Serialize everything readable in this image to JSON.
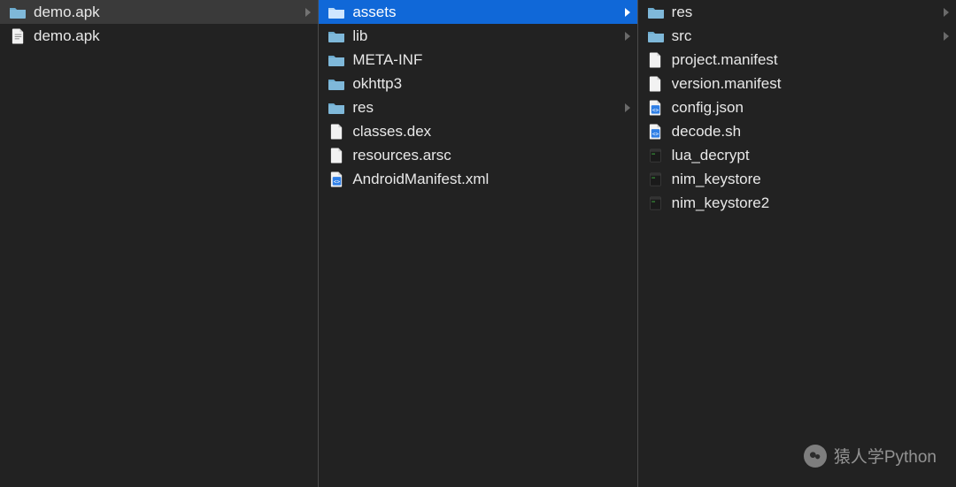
{
  "columns": [
    {
      "items": [
        {
          "name": "demo.apk",
          "kind": "folder",
          "expandable": true,
          "state": "selected-inactive"
        },
        {
          "name": "demo.apk",
          "kind": "file-doc",
          "expandable": false,
          "state": "normal"
        }
      ]
    },
    {
      "items": [
        {
          "name": "assets",
          "kind": "folder",
          "expandable": true,
          "state": "selected-active"
        },
        {
          "name": "lib",
          "kind": "folder",
          "expandable": true,
          "state": "normal"
        },
        {
          "name": "META-INF",
          "kind": "folder",
          "expandable": false,
          "state": "normal"
        },
        {
          "name": "okhttp3",
          "kind": "folder",
          "expandable": false,
          "state": "normal"
        },
        {
          "name": "res",
          "kind": "folder",
          "expandable": true,
          "state": "normal"
        },
        {
          "name": "classes.dex",
          "kind": "file",
          "expandable": false,
          "state": "normal"
        },
        {
          "name": "resources.arsc",
          "kind": "file",
          "expandable": false,
          "state": "normal"
        },
        {
          "name": "AndroidManifest.xml",
          "kind": "file-code",
          "expandable": false,
          "state": "normal"
        }
      ]
    },
    {
      "items": [
        {
          "name": "res",
          "kind": "folder",
          "expandable": true,
          "state": "normal"
        },
        {
          "name": "src",
          "kind": "folder",
          "expandable": true,
          "state": "normal"
        },
        {
          "name": "project.manifest",
          "kind": "file",
          "expandable": false,
          "state": "normal"
        },
        {
          "name": "version.manifest",
          "kind": "file",
          "expandable": false,
          "state": "normal"
        },
        {
          "name": "config.json",
          "kind": "file-code",
          "expandable": false,
          "state": "normal"
        },
        {
          "name": "decode.sh",
          "kind": "file-code",
          "expandable": false,
          "state": "normal"
        },
        {
          "name": "lua_decrypt",
          "kind": "file-exec",
          "expandable": false,
          "state": "normal"
        },
        {
          "name": "nim_keystore",
          "kind": "file-exec",
          "expandable": false,
          "state": "normal"
        },
        {
          "name": "nim_keystore2",
          "kind": "file-exec",
          "expandable": false,
          "state": "normal"
        }
      ]
    }
  ],
  "watermark": {
    "text": "猿人学Python"
  }
}
